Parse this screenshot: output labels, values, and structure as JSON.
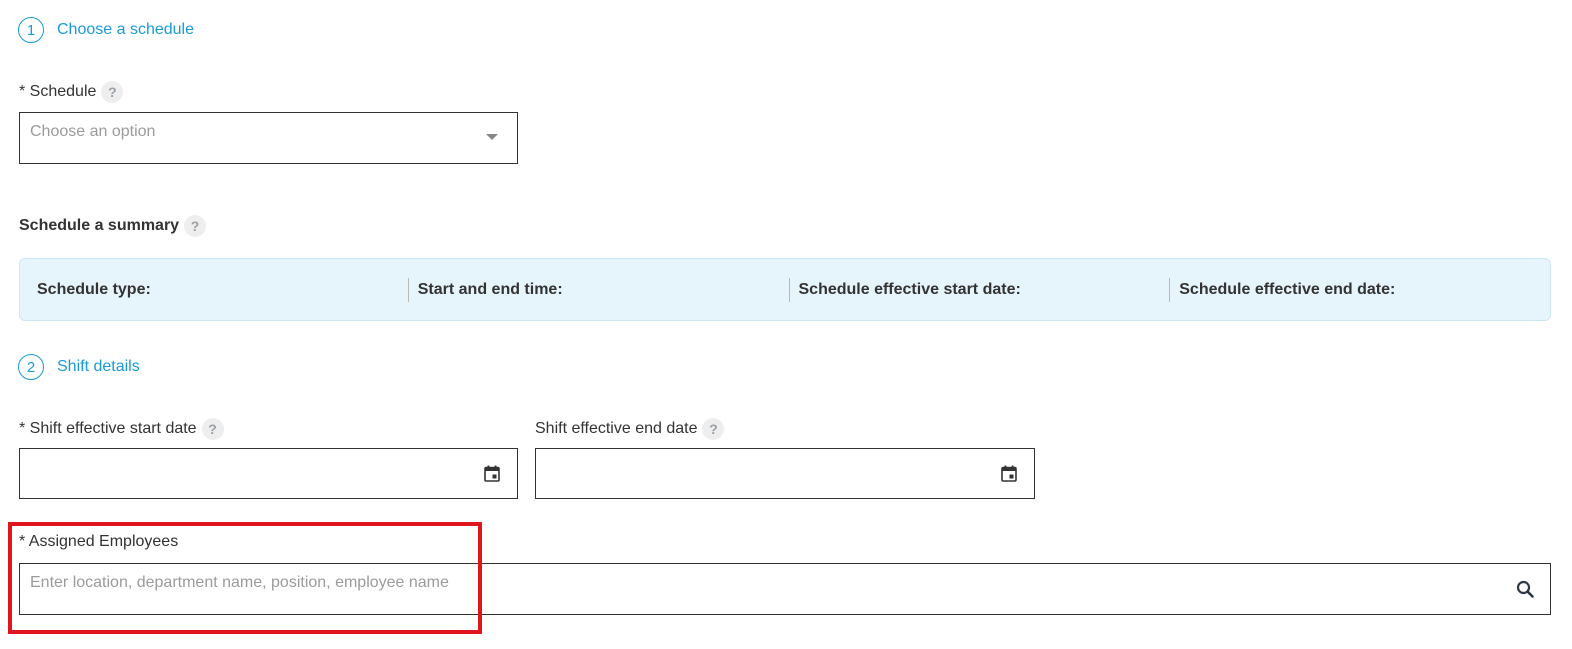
{
  "step1": {
    "number": "1",
    "title": "Choose a schedule"
  },
  "schedule": {
    "label": "* Schedule",
    "help": "?",
    "placeholder": "Choose an option"
  },
  "summary": {
    "title": "Schedule a summary",
    "help": "?",
    "columns": [
      "Schedule type:",
      "Start and end time:",
      "Schedule effective start date:",
      "Schedule effective end date:"
    ]
  },
  "step2": {
    "number": "2",
    "title": "Shift details"
  },
  "shift_start": {
    "label": "* Shift effective start date",
    "help": "?",
    "value": ""
  },
  "shift_end": {
    "label": "Shift effective end date",
    "help": "?",
    "value": ""
  },
  "employees": {
    "label": "* Assigned Employees",
    "placeholder": "Enter location, department name, position, employee name"
  },
  "icons": {
    "calendar": "calendar-icon",
    "search": "search-icon",
    "dropdown": "chevron-down-icon"
  },
  "colors": {
    "accent": "#1a9bd7",
    "summary_bg": "#e6f4fb",
    "highlight": "#e0161f"
  }
}
